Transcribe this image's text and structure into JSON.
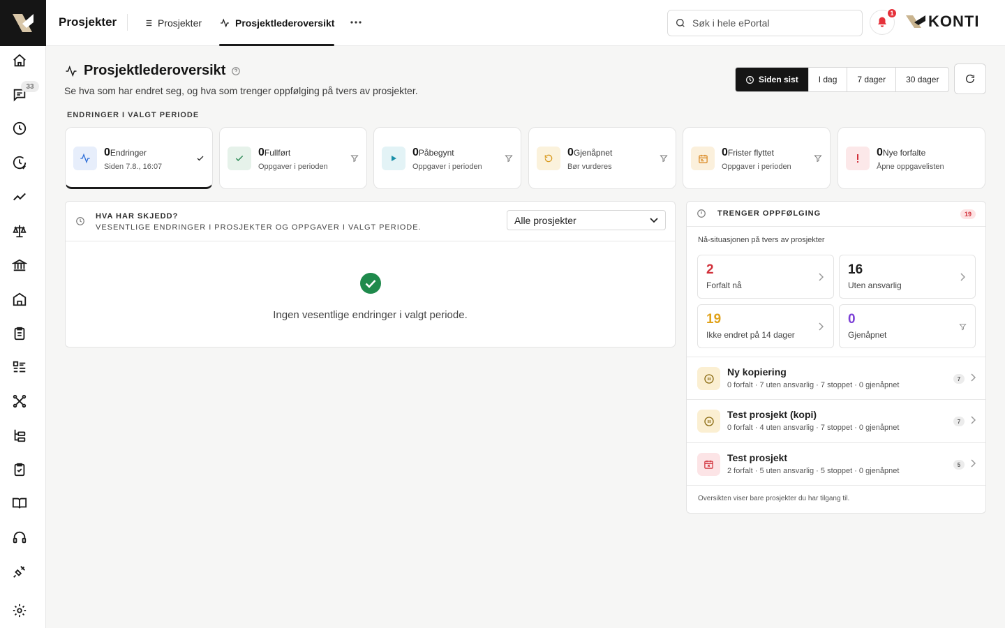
{
  "topbar": {
    "app_title": "Prosjekter",
    "tabs": [
      {
        "label": "Prosjekter",
        "icon": "list-icon"
      },
      {
        "label": "Prosjektlederoversikt",
        "icon": "activity-icon"
      }
    ],
    "more_icon": "more-horizontal-icon",
    "search_placeholder": "Søk i hele ePortal",
    "notification_count": "1",
    "brand_text": "KONTI"
  },
  "sidebar": {
    "items": [
      {
        "icon": "home-icon"
      },
      {
        "icon": "messages-icon",
        "badge": "33"
      },
      {
        "icon": "clock-icon"
      },
      {
        "icon": "history-icon"
      },
      {
        "icon": "trend-icon"
      },
      {
        "icon": "scale-icon"
      },
      {
        "icon": "bank-icon"
      },
      {
        "icon": "building-icon"
      },
      {
        "icon": "clipboard-icon"
      },
      {
        "icon": "list-checks-icon"
      },
      {
        "icon": "network-icon"
      },
      {
        "icon": "tree-icon"
      },
      {
        "icon": "clipboard-check-icon"
      },
      {
        "icon": "book-icon"
      },
      {
        "icon": "headset-icon"
      },
      {
        "icon": "plug-icon"
      },
      {
        "icon": "settings-icon"
      }
    ]
  },
  "page": {
    "title": "Prosjektlederoversikt",
    "subtitle": "Se hva som har endret seg, og hva som trenger oppfølging på tvers av prosjekter.",
    "periods": [
      "Siden sist",
      "I dag",
      "7 dager",
      "30 dager"
    ],
    "active_period": "Siden sist",
    "section_label": "ENDRINGER I VALGT PERIODE"
  },
  "stats": [
    {
      "count": "0",
      "label": "Endringer",
      "sub": "Siden 7.8., 16:07",
      "icon": "activity-icon",
      "action": "check-icon",
      "color": "#2f6fd8"
    },
    {
      "count": "0",
      "label": "Fullført",
      "sub": "Oppgaver i perioden",
      "icon": "check-icon",
      "action": "filter-icon",
      "color": "#2e8b57"
    },
    {
      "count": "0",
      "label": "Påbegynt",
      "sub": "Oppgaver i perioden",
      "icon": "play-icon",
      "action": "filter-icon",
      "color": "#1a8fa8"
    },
    {
      "count": "0",
      "label": "Gjenåpnet",
      "sub": "Bør vurderes",
      "icon": "rotate-icon",
      "action": "filter-icon",
      "color": "#d99a1e"
    },
    {
      "count": "0",
      "label": "Frister flyttet",
      "sub": "Oppgaver i perioden",
      "icon": "calendar-icon",
      "action": "filter-icon",
      "color": "#d9861e"
    },
    {
      "count": "0",
      "label": "Nye forfalte",
      "sub": "Åpne oppgavelisten",
      "icon": "alert-icon",
      "action": "",
      "color": "#d1303a"
    }
  ],
  "changes_panel": {
    "title": "HVA HAR SKJEDD?",
    "subtitle": "VESENTLIGE ENDRINGER I PROSJEKTER OG OPPGAVER I VALGT PERIODE.",
    "select_value": "Alle prosjekter",
    "empty_text": "Ingen vesentlige endringer i valgt periode."
  },
  "followup": {
    "title": "TRENGER OPPFØLGING",
    "badge": "19",
    "subtitle": "Nå-situasjonen på tvers av prosjekter",
    "cards": [
      {
        "value": "2",
        "label": "Forfalt nå",
        "color": "#d1303a",
        "action": "chevron-right-icon"
      },
      {
        "value": "16",
        "label": "Uten ansvarlig",
        "color": "#1f1f1f",
        "action": "chevron-right-icon"
      },
      {
        "value": "19",
        "label": "Ikke endret på 14 dager",
        "color": "#e0a21a",
        "action": "chevron-right-icon"
      },
      {
        "value": "0",
        "label": "Gjenåpnet",
        "color": "#7b3fd6",
        "action": "filter-icon"
      }
    ],
    "projects": [
      {
        "name": "Ny kopiering",
        "stats": "0 forfalt · 7 uten ansvarlig · 7 stoppet · 0 gjenåpnet",
        "count": "7",
        "icon": "pause-icon",
        "tone": "yellow"
      },
      {
        "name": "Test prosjekt (kopi)",
        "stats": "0 forfalt · 4 uten ansvarlig · 7 stoppet · 0 gjenåpnet",
        "count": "7",
        "icon": "pause-icon",
        "tone": "yellow"
      },
      {
        "name": "Test prosjekt",
        "stats": "2 forfalt · 5 uten ansvarlig · 5 stoppet · 0 gjenåpnet",
        "count": "5",
        "icon": "calendar-x-icon",
        "tone": "red"
      }
    ],
    "footer": "Oversikten viser bare prosjekter du har tilgang til."
  }
}
